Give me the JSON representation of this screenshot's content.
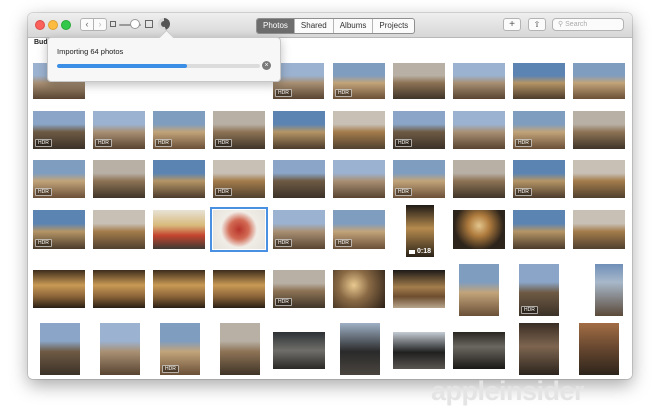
{
  "toolbar": {
    "tabs": [
      {
        "label": "Photos",
        "active": true
      },
      {
        "label": "Shared",
        "active": false
      },
      {
        "label": "Albums",
        "active": false
      },
      {
        "label": "Projects",
        "active": false
      }
    ],
    "search_placeholder": "Search",
    "zoom_icon": "photo-size-icons",
    "activity_icon": "progress-ring-icon",
    "add_icon": "plus-icon",
    "share_icon": "share-icon"
  },
  "content": {
    "section_title_partial": "Bud"
  },
  "import": {
    "status": "Importing 64 photos",
    "progress": 0.64,
    "cancel_icon": "close-icon"
  },
  "badges": {
    "hdr": "HDR",
    "video_duration": "0:18"
  },
  "watermark": "appleinsider"
}
